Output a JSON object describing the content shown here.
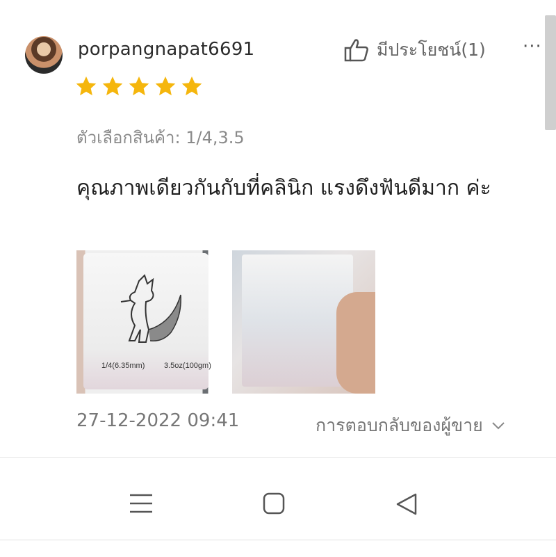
{
  "review": {
    "username": "porpangnapat6691",
    "rating": 5,
    "helpful_label": "มีประโยชน์(1)",
    "more_label": "···",
    "variation": "ตัวเลือกสินค้า: 1/4,3.5",
    "comment": "คุณภาพเดียวกันกับที่คลินิก แรงดึงฟันดีมาก ค่ะ",
    "photo1_text_left": "1/4(6.35mm)",
    "photo1_text_right": "3.5oz(100gm)",
    "date": "27-12-2022 09:41",
    "seller_reply_label": "การตอบกลับของผู้ขาย"
  },
  "colors": {
    "star": "#f5b60d",
    "text_muted": "#8a8a8a"
  },
  "icons": {
    "helpful": "thumbs-up-icon",
    "more": "more-dots-icon",
    "expand": "chevron-down-icon",
    "nav_menu": "menu-icon",
    "nav_home": "home-square-icon",
    "nav_back": "back-triangle-icon"
  }
}
